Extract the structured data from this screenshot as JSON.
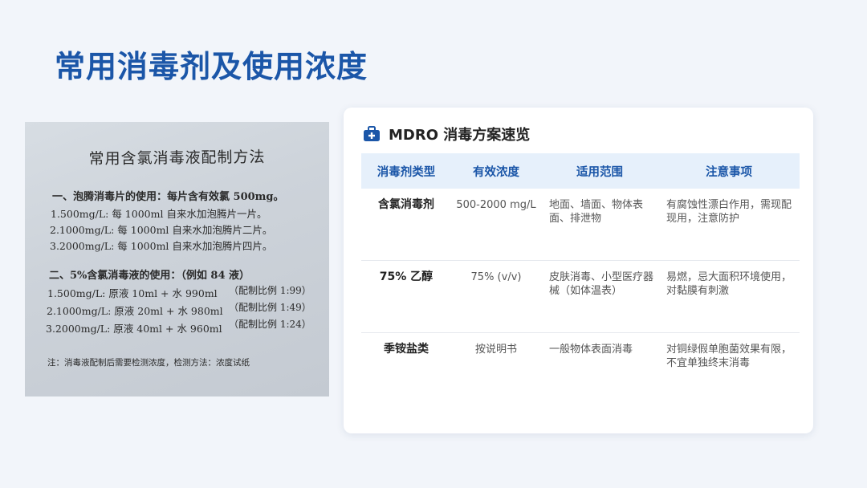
{
  "slide": {
    "title": "常用消毒剂及使用浓度"
  },
  "photo": {
    "title": "常用含氯消毒液配制方法",
    "section1": "一、泡腾消毒片的使用：每片含有效氯 500mg。",
    "s1_lines": [
      "1.500mg/L:  每 1000ml 自来水加泡腾片一片。",
      "2.1000mg/L: 每 1000ml 自来水加泡腾片二片。",
      "3.2000mg/L: 每 1000ml 自来水加泡腾片四片。"
    ],
    "section2": "二、5%含氯消毒液的使用：（例如 84 液）",
    "s2_lines": [
      "1.500mg/L:   原液 10ml + 水 990ml",
      "2.1000mg/L:  原液 20ml + 水 980ml",
      "3.2000mg/L:  原液 40ml + 水 960ml"
    ],
    "s2_ratios": [
      "（配制比例 1:99）",
      "（配制比例 1:49）",
      "（配制比例 1:24）"
    ],
    "note": "注：消毒液配制后需要检测浓度，检测方法：浓度试纸"
  },
  "card": {
    "icon": "medical-kit-icon",
    "title": "MDRO 消毒方案速览",
    "headers": [
      "消毒剂类型",
      "有效浓度",
      "适用范围",
      "注意事项"
    ],
    "rows": [
      {
        "name": "含氯消毒剂",
        "conc": "500-2000 mg/L",
        "scope": "地面、墙面、物体表面、排泄物",
        "note": "有腐蚀性漂白作用，需现配现用，注意防护"
      },
      {
        "name": "75% 乙醇",
        "conc": "75% (v/v)",
        "scope": "皮肤消毒、小型医疗器械（如体温表）",
        "note": "易燃，忌大面积环境使用，对黏膜有刺激"
      },
      {
        "name": "季铵盐类",
        "conc": "按说明书",
        "scope": "一般物体表面消毒",
        "note": "对铜绿假单胞菌效果有限，不宜单独终末消毒"
      }
    ]
  },
  "colors": {
    "accent": "#1b56a8",
    "header_bg": "#e6f0fb",
    "page_bg": "#f2f5fa"
  }
}
